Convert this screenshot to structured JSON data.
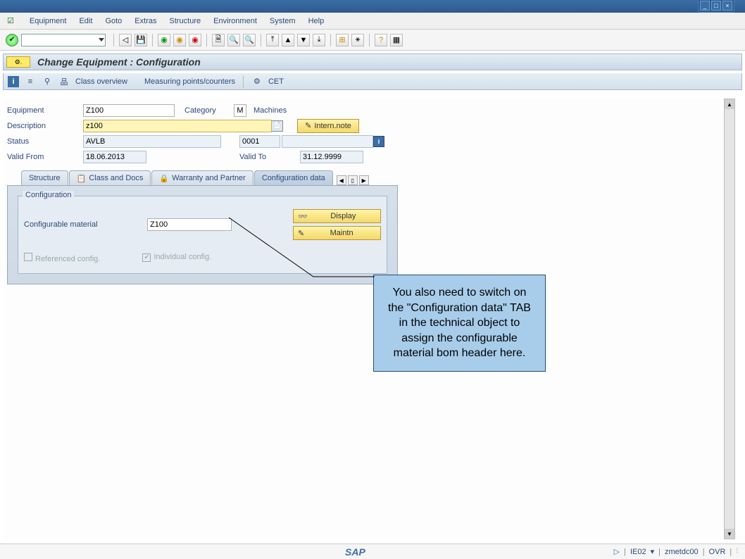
{
  "window": {
    "minimize": "_",
    "maximize": "□",
    "close": "×"
  },
  "menubar": {
    "items": [
      "Equipment",
      "Edit",
      "Goto",
      "Extras",
      "Structure",
      "Environment",
      "System",
      "Help"
    ],
    "underlines": [
      "E",
      "E",
      "G",
      "E",
      "S",
      "E",
      "S",
      "H"
    ]
  },
  "app": {
    "header_icon": "⚙",
    "title": "Change Equipment : Configuration",
    "toolbar_links": {
      "class_overview": "Class overview",
      "measuring": "Measuring points/counters",
      "cet": "CET"
    }
  },
  "form": {
    "equipment_label": "Equipment",
    "equipment_value": "Z100",
    "category_label": "Category",
    "category_value": "M",
    "category_text": "Machines",
    "description_label": "Description",
    "description_value": "z100",
    "intern_note": "Intern.note",
    "status_label": "Status",
    "status_value": "AVLB",
    "status_code": "0001",
    "valid_from_label": "Valid From",
    "valid_from_value": "18.06.2013",
    "valid_to_label": "Valid To",
    "valid_to_value": "31.12.9999"
  },
  "tabs": {
    "structure": "Structure",
    "class_docs": "Class and Docs",
    "warranty": "Warranty and Partner",
    "config": "Configuration data",
    "nav": {
      "prev": "◀",
      "list": "▯",
      "next": "▶"
    }
  },
  "config": {
    "group_title": "Configuration",
    "material_label": "Configurable material",
    "material_value": "Z100",
    "display_btn": "Display",
    "maintn_btn": "Maintn",
    "referenced": "Referenced config.",
    "individual": "Individual config."
  },
  "callout": {
    "text": "You also need to switch on the \"Configuration data\" TAB in the technical object to assign the configurable material bom header here."
  },
  "statusbar": {
    "sap": "SAP",
    "tcode": "IE02",
    "server": "zmetdc00",
    "ovr": "OVR",
    "tri": "▷",
    "drop": "▾"
  }
}
